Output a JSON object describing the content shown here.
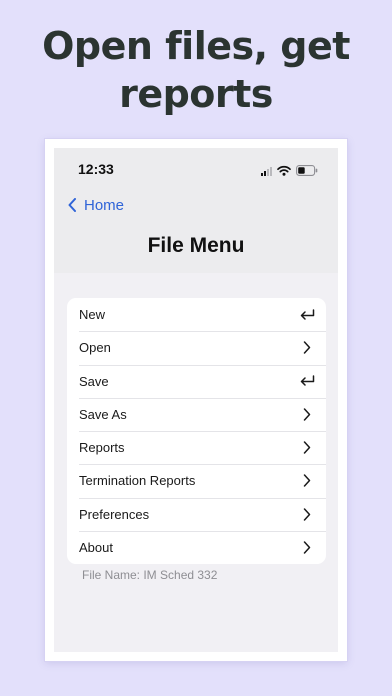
{
  "promo": {
    "headline_line1": "Open files, get",
    "headline_line2": "reports"
  },
  "status_bar": {
    "time": "12:33"
  },
  "nav": {
    "back_label": "Home",
    "title": "File Menu"
  },
  "menu": {
    "items": [
      {
        "label": "New",
        "icon": "return-icon"
      },
      {
        "label": "Open",
        "icon": "chevron-right-icon"
      },
      {
        "label": "Save",
        "icon": "return-icon"
      },
      {
        "label": "Save As",
        "icon": "chevron-right-icon"
      },
      {
        "label": "Reports",
        "icon": "chevron-right-icon"
      },
      {
        "label": "Termination Reports",
        "icon": "chevron-right-icon"
      },
      {
        "label": "Preferences",
        "icon": "chevron-right-icon"
      },
      {
        "label": "About",
        "icon": "chevron-right-icon"
      }
    ]
  },
  "footer": {
    "file_name": "File Name: IM Sched 332"
  },
  "colors": {
    "background": "#e3e0fb",
    "accent": "#2f64d8",
    "headline": "#2b3431"
  }
}
